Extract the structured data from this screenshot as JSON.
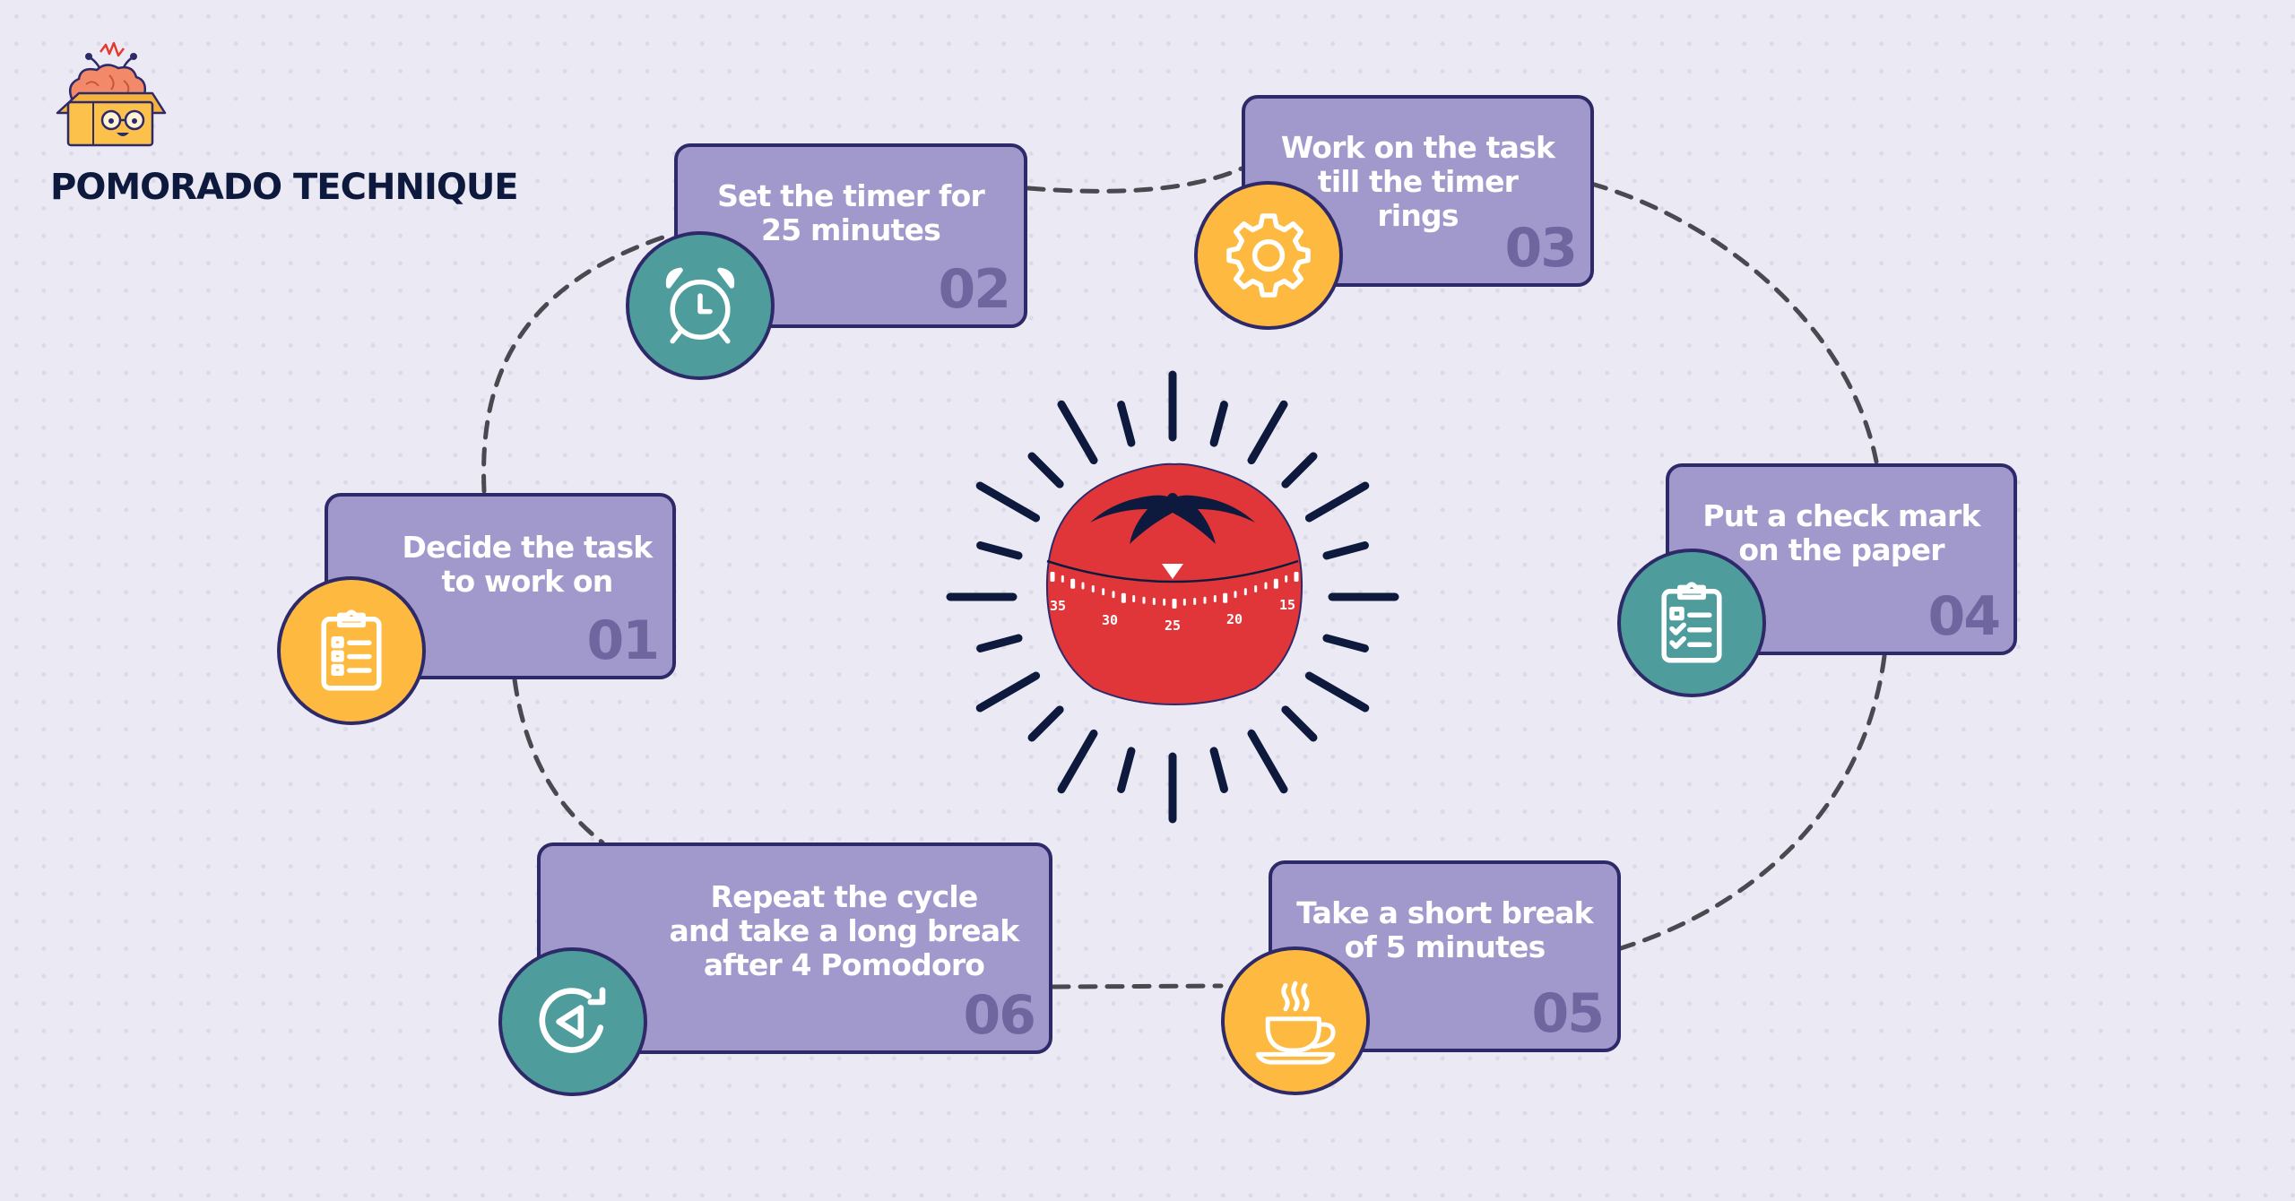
{
  "header": {
    "title": "POMORADO TECHNIQUE",
    "logo": "brain-in-box-mascot"
  },
  "colors": {
    "background": "#ebe9f4",
    "card_fill": "#a199cb",
    "card_border": "#2e2a6a",
    "card_number": "#6f66a0",
    "teal": "#4e9c9c",
    "yellow": "#fdb940",
    "tomato": "#e0363a",
    "navy": "#0e1a3d",
    "connector": "#4a4950"
  },
  "steps": [
    {
      "number": "01",
      "text": "Decide the task\nto work on",
      "icon": "clipboard-list-icon",
      "badge_color": "yellow"
    },
    {
      "number": "02",
      "text": "Set the timer for\n25 minutes",
      "icon": "alarm-clock-icon",
      "badge_color": "teal"
    },
    {
      "number": "03",
      "text": "Work on the task\ntill the timer\nrings",
      "icon": "gear-icon",
      "badge_color": "yellow"
    },
    {
      "number": "04",
      "text": "Put a check mark\non the paper",
      "icon": "clipboard-check-icon",
      "badge_color": "teal"
    },
    {
      "number": "05",
      "text": "Take a short break\nof 5 minutes",
      "icon": "coffee-cup-icon",
      "badge_color": "yellow"
    },
    {
      "number": "06",
      "text": "Repeat the cycle\nand take a long break\nafter 4 Pomodoro",
      "icon": "repeat-play-icon",
      "badge_color": "teal"
    }
  ],
  "timer": {
    "icon": "tomato-timer",
    "dial_labels": [
      "35",
      "30",
      "25",
      "20",
      "15"
    ],
    "pointer_value": "25"
  }
}
